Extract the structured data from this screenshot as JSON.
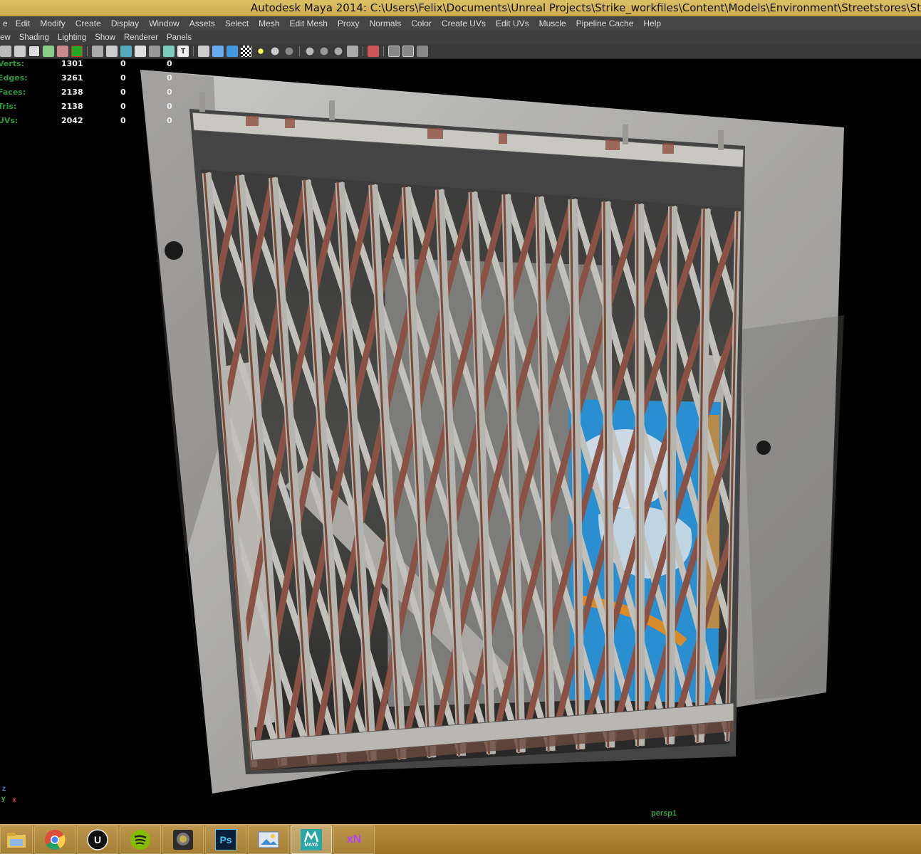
{
  "window": {
    "title": "Autodesk Maya 2014: C:\\Users\\Felix\\Documents\\Unreal Projects\\Strike_workfiles\\Content\\Models\\Environment\\Streetstores\\St"
  },
  "menubar": {
    "items": [
      "Edit",
      "Modify",
      "Create",
      "Display",
      "Window",
      "Assets",
      "Select",
      "Mesh",
      "Edit Mesh",
      "Proxy",
      "Normals",
      "Color",
      "Create UVs",
      "Edit UVs",
      "Muscle",
      "Pipeline Cache",
      "Help"
    ],
    "leading_fragment": "e"
  },
  "panelbar": {
    "items": [
      "ew",
      "Shading",
      "Lighting",
      "Show",
      "Renderer",
      "Panels"
    ]
  },
  "hud": {
    "rows": [
      {
        "label": "Verts:",
        "v1": "1301",
        "v2": "0",
        "v3": "0"
      },
      {
        "label": "Edges:",
        "v1": "3261",
        "v2": "0",
        "v3": "0"
      },
      {
        "label": "Faces:",
        "v1": "2138",
        "v2": "0",
        "v3": "0"
      },
      {
        "label": "Tris:",
        "v1": "2138",
        "v2": "0",
        "v3": "0"
      },
      {
        "label": "UVs:",
        "v1": "2042",
        "v2": "0",
        "v3": "0"
      }
    ]
  },
  "viewport": {
    "camera": "persp1",
    "axis": {
      "z": "z",
      "x": "x",
      "y": "y"
    },
    "graffiti_colors": [
      "#2a8fd0",
      "#e6e6e6",
      "#8a4a2a",
      "#d98a2a"
    ]
  },
  "taskbar": {
    "apps": [
      {
        "name": "file-explorer-icon",
        "label": "",
        "active": false
      },
      {
        "name": "chrome-icon",
        "label": "",
        "active": false
      },
      {
        "name": "unreal-engine-icon",
        "label": "",
        "active": false
      },
      {
        "name": "spotify-icon",
        "label": "",
        "active": false
      },
      {
        "name": "camera-app-icon",
        "label": "",
        "active": false
      },
      {
        "name": "photoshop-icon",
        "label": "Ps",
        "active": false
      },
      {
        "name": "photo-viewer-icon",
        "label": "",
        "active": false
      },
      {
        "name": "maya-icon",
        "label": "MAYA",
        "active": true
      },
      {
        "name": "xnormal-icon",
        "label": "xN",
        "active": false
      }
    ]
  }
}
